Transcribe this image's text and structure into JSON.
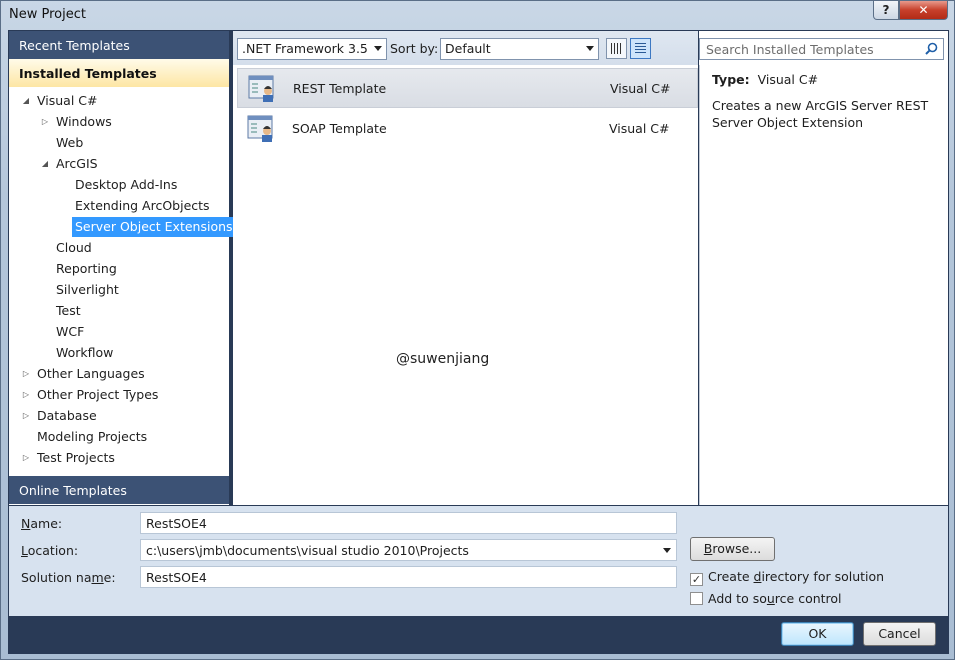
{
  "window": {
    "title": "New Project",
    "help_label": "?",
    "close_label": "✕"
  },
  "left_pane": {
    "recent_header": "Recent Templates",
    "installed_header": "Installed Templates",
    "online_header": "Online Templates",
    "tree": [
      {
        "label": "Visual C#",
        "arrow": "◢"
      },
      {
        "label": "Windows",
        "arrow": "▷"
      },
      {
        "label": "Web",
        "arrow": ""
      },
      {
        "label": "ArcGIS",
        "arrow": "◢"
      },
      {
        "label": "Desktop Add-Ins",
        "arrow": ""
      },
      {
        "label": "Extending ArcObjects",
        "arrow": ""
      },
      {
        "label": "Server Object Extensions",
        "arrow": ""
      },
      {
        "label": "Cloud",
        "arrow": ""
      },
      {
        "label": "Reporting",
        "arrow": ""
      },
      {
        "label": "Silverlight",
        "arrow": ""
      },
      {
        "label": "Test",
        "arrow": ""
      },
      {
        "label": "WCF",
        "arrow": ""
      },
      {
        "label": "Workflow",
        "arrow": ""
      },
      {
        "label": "Other Languages",
        "arrow": "▷"
      },
      {
        "label": "Other Project Types",
        "arrow": "▷"
      },
      {
        "label": "Database",
        "arrow": "▷"
      },
      {
        "label": "Modeling Projects",
        "arrow": ""
      },
      {
        "label": "Test Projects",
        "arrow": "▷"
      }
    ],
    "selected_item": "Server Object Extensions"
  },
  "toolbar": {
    "framework": ".NET Framework 3.5",
    "sort_label": "Sort by:",
    "sort_value": "Default"
  },
  "templates": [
    {
      "name": "REST Template",
      "language": "Visual C#"
    },
    {
      "name": "SOAP Template",
      "language": "Visual C#"
    }
  ],
  "watermark": "@suwenjiang",
  "search": {
    "placeholder": "Search Installed Templates"
  },
  "details": {
    "type_label": "Type:",
    "type_value": "Visual C#",
    "description": "Creates a new ArcGIS Server REST Server Object Extension"
  },
  "form": {
    "name_label": "Name:",
    "name_value": "RestSOE4",
    "location_label": "Location:",
    "location_value": "c:\\users\\jmb\\documents\\visual studio 2010\\Projects",
    "solution_label": "Solution name:",
    "solution_value": "RestSOE4",
    "browse_label": "Browse...",
    "create_dir_label": "Create directory for solution",
    "create_dir_checked": true,
    "source_control_label": "Add to source control",
    "source_control_checked": false
  },
  "buttons": {
    "ok": "OK",
    "cancel": "Cancel"
  },
  "colors": {
    "selection": "#3399ff",
    "pane_header": "#3c5275",
    "installed_header": "#fde6a4"
  }
}
